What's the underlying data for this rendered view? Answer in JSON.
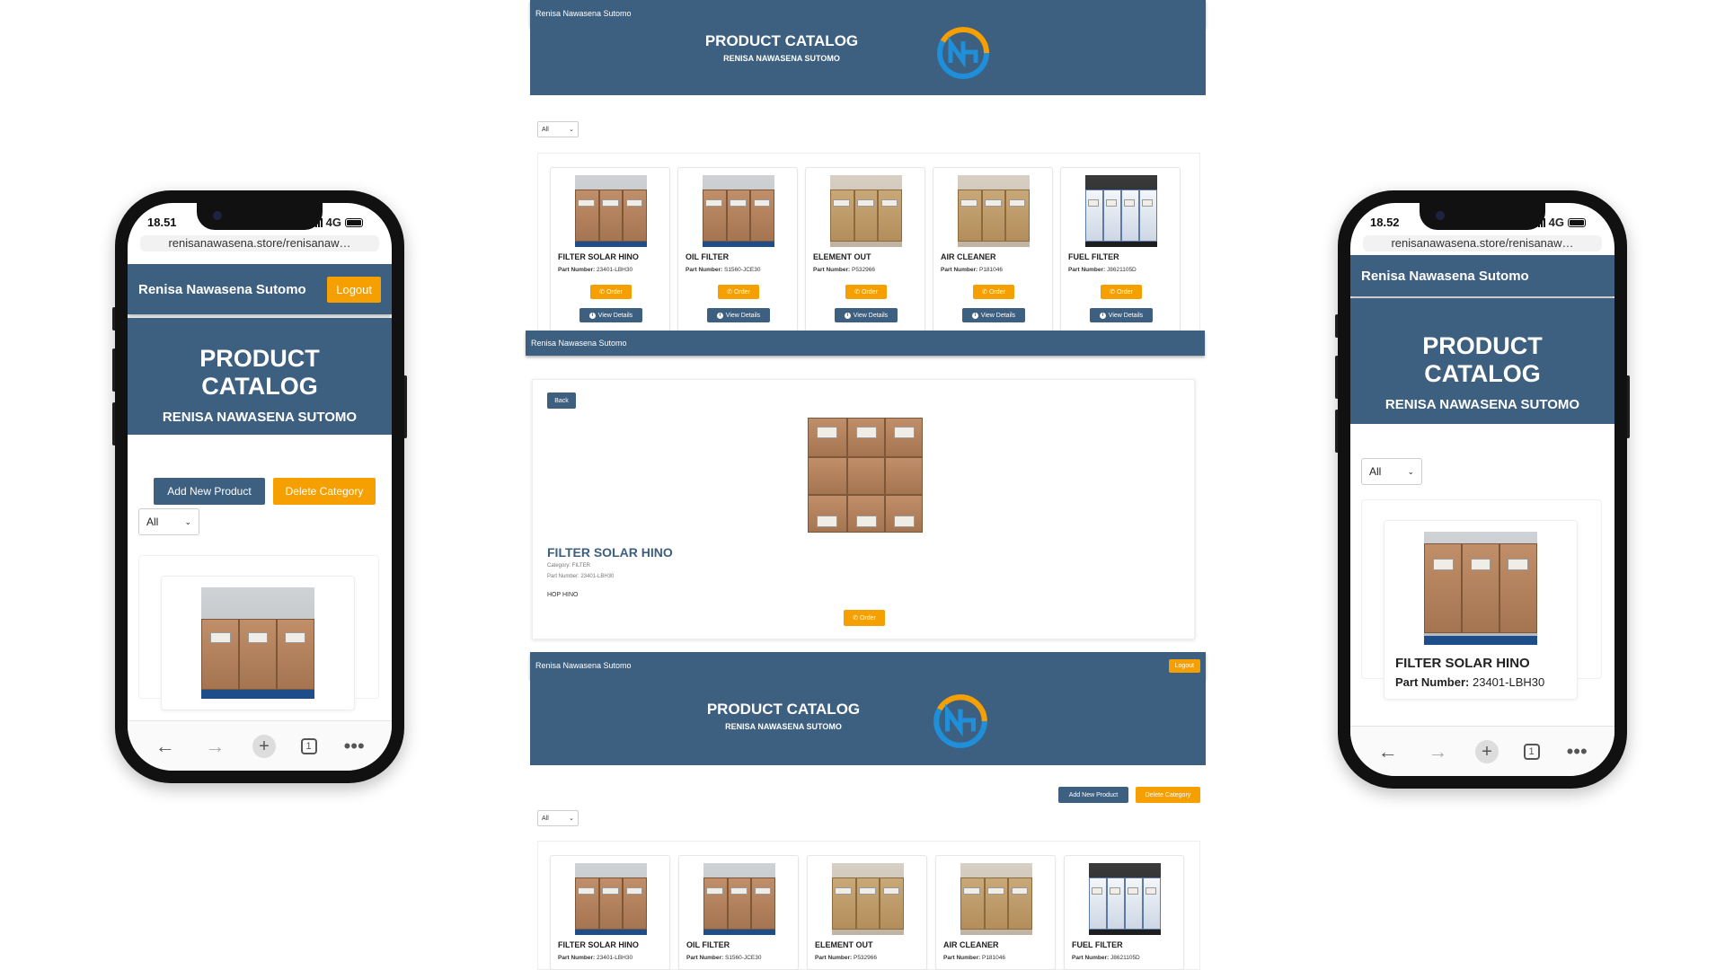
{
  "brand_name": "Renisa Nawasena Sutomo",
  "catalog_title": "PRODUCT CATALOG",
  "catalog_subtitle": "RENISA NAWASENA SUTOMO",
  "logout_label": "Logout",
  "add_product_label": "Add New Product",
  "delete_category_label": "Delete Category",
  "filter_value": "All",
  "order_label": "Order",
  "view_details_label": "View Details",
  "part_number_label": "Part Number:",
  "colors": {
    "primary": "#3d5f80",
    "accent": "#f5a000"
  },
  "phone_left": {
    "time": "18.51",
    "network": "4G",
    "url": "renisanawasena.store/renisanaw…",
    "tab_count": "1"
  },
  "phone_right": {
    "time": "18.52",
    "network": "4G",
    "url": "renisanawasena.store/renisanaw…",
    "tab_count": "1",
    "product_name": "FILTER SOLAR HINO",
    "product_part": "23401-LBH30"
  },
  "products": [
    {
      "name": "FILTER SOLAR HINO",
      "part": "23401-LBH30"
    },
    {
      "name": "OIL FILTER",
      "part": "S1560-JCE30"
    },
    {
      "name": "ELEMENT OUT",
      "part": "P532966"
    },
    {
      "name": "AIR CLEANER",
      "part": "P181046"
    },
    {
      "name": "FUEL FILTER",
      "part": "J8621105D"
    }
  ],
  "detail": {
    "back_label": "Back",
    "name": "FILTER SOLAR HINO",
    "category": "Category: FILTER",
    "part": "Part Number: 23401-LBH30",
    "description": "HOP HINO"
  }
}
